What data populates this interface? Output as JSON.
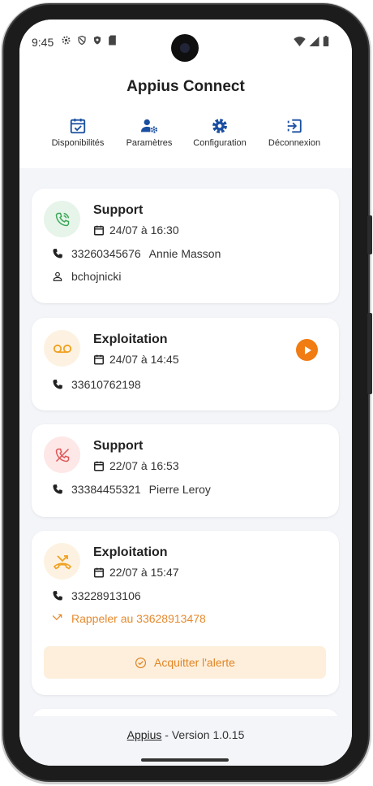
{
  "status_bar": {
    "time": "9:45"
  },
  "app": {
    "title": "Appius Connect"
  },
  "nav": {
    "items": [
      {
        "label": "Disponibilités",
        "icon": "calendar-check-icon"
      },
      {
        "label": "Paramètres",
        "icon": "user-settings-icon"
      },
      {
        "label": "Configuration",
        "icon": "gear-icon"
      },
      {
        "label": "Déconnexion",
        "icon": "logout-icon"
      }
    ],
    "accent": "#1a4fa0"
  },
  "calls": [
    {
      "queue": "Support",
      "datetime": "24/07 à 16:30",
      "phone": "33260345676",
      "contact": "Annie Masson",
      "agent": "bchojnicki",
      "status": "answered",
      "color": "#3aa655"
    },
    {
      "queue": "Exploitation",
      "datetime": "24/07 à 14:45",
      "phone": "33610762198",
      "status": "voicemail",
      "color": "#f0a020"
    },
    {
      "queue": "Support",
      "datetime": "22/07 à 16:53",
      "phone": "33384455321",
      "contact": "Pierre Leroy",
      "status": "missed",
      "color": "#e05555"
    },
    {
      "queue": "Exploitation",
      "datetime": "22/07 à 15:47",
      "phone": "33228913106",
      "callback": "Rappeler au 33628913478",
      "ack_label": "Acquitter l'alerte",
      "status": "missed-alert",
      "color": "#f0a020"
    }
  ],
  "footer": {
    "link": "Appius",
    "version_text": " - Version 1.0.15"
  }
}
